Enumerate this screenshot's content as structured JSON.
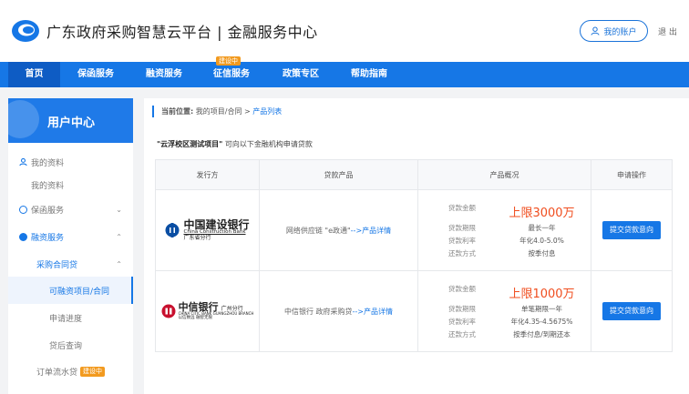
{
  "header": {
    "title": "广东政府采购智慧云平台 | 金融服务中心",
    "account_label": "我的账户",
    "logout_label": "退 出"
  },
  "nav": {
    "items": [
      {
        "label": "首页",
        "active": true
      },
      {
        "label": "保函服务"
      },
      {
        "label": "融资服务"
      },
      {
        "label": "征信服务",
        "badge": "建设中"
      },
      {
        "label": "政策专区"
      },
      {
        "label": "帮助指南"
      }
    ]
  },
  "sidebar": {
    "title": "用户中心",
    "items": [
      {
        "label": "我的资料",
        "icon": "user-icon"
      },
      {
        "label": "我的资料"
      },
      {
        "label": "保函服务",
        "icon": "guarantee-icon"
      },
      {
        "label": "融资服务",
        "icon": "finance-icon"
      },
      {
        "label": "采购合同贷"
      },
      {
        "label": "可融资项目/合同",
        "selected": true
      },
      {
        "label": "申请进度"
      },
      {
        "label": "贷后查询"
      },
      {
        "label": "订单流水贷",
        "badge": "建设中"
      }
    ]
  },
  "breadcrumb": {
    "prefix": "当前位置:",
    "path": "我的项目/合同 >",
    "current": "产品列表"
  },
  "intro": {
    "project": "\"云浮校区测试项目\"",
    "text": "可向以下金融机构申请贷款"
  },
  "table": {
    "headers": [
      "发行方",
      "贷款产品",
      "产品概况",
      "申请操作"
    ],
    "rows": [
      {
        "bank_name": "中国建设银行",
        "bank_en": "China Construction Bank",
        "bank_branch": "广东省分行",
        "product_text": "网络供应链 \"e政通\"",
        "product_link": "-->产品详情",
        "amount_label": "贷款金额",
        "amount": "上限3000万",
        "term_label": "贷款期限",
        "term": "最长一年",
        "rate_label": "贷款利率",
        "rate": "年化4.0-5.0%",
        "repay_label": "还款方式",
        "repay": "按季付息",
        "button": "提交贷款意向"
      },
      {
        "bank_name": "中信银行",
        "bank_en": "CHINA CITIC BANK",
        "bank_branch": "广州分行",
        "bank_branch_en": "GUANGZHOU BRANCH",
        "bank_slogan": "以信致远 融智无限",
        "product_text": "中信银行 政府采购贷",
        "product_link": "-->产品详情",
        "amount_label": "贷款金额",
        "amount": "上限1000万",
        "term_label": "贷款期限",
        "term": "单笔期限一年",
        "rate_label": "贷款利率",
        "rate": "年化4.35-4.5675%",
        "repay_label": "还款方式",
        "repay": "按季付息/到期还本",
        "button": "提交贷款意向"
      }
    ]
  },
  "colors": {
    "primary": "#1677e6",
    "accent_orange": "#f29a1f",
    "highlight_red": "#f04d1e",
    "ccb_blue": "#0a4ea3",
    "citic_red": "#c8102e"
  }
}
